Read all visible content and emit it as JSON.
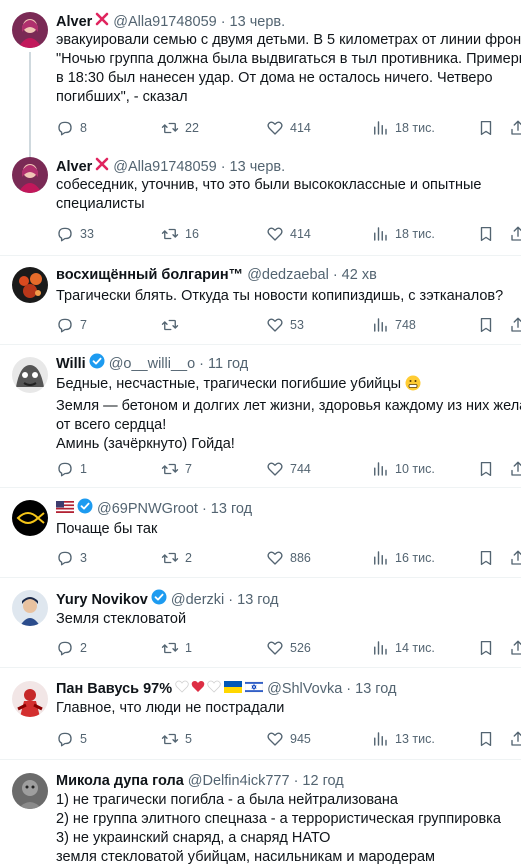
{
  "tweets": [
    {
      "name": "Alver",
      "handle": "@Alla91748059",
      "time": "13 черв.",
      "lines": [
        "эвакуировали семью с двумя детьми. В 5 километрах от линии фронта.",
        "\"Ночью группа должна была выдвигаться в тыл противника. Примерно",
        "в 18:30 был нанесен удар. От дома не осталось ничего. Четверо",
        "погибших\", - сказал"
      ],
      "replies": "8",
      "reposts": "22",
      "likes": "414",
      "views": "18 тис."
    },
    {
      "name": "Alver",
      "handle": "@Alla91748059",
      "time": "13 черв.",
      "lines": [
        "собеседник, уточнив, что это были высококлассные и опытные",
        "специалисты"
      ],
      "replies": "33",
      "reposts": "16",
      "likes": "414",
      "views": "18 тис."
    },
    {
      "name": "восхищённый болгарин™",
      "handle": "@dedzaebal",
      "time": "42 хв",
      "lines": [
        "Трагически блять. Откуда ты новости копипиздишь, с зэтканалов?"
      ],
      "replies": "7",
      "reposts": "",
      "likes": "53",
      "views": "748"
    },
    {
      "name": "Willi",
      "handle": "@o__willi__o",
      "time": "11 год",
      "lines": [
        "Бедные, несчастные, трагически погибшие убийцы",
        "Земля — бетоном и долгих лет жизни, здоровья каждому из них желаю,",
        "от всего сердца!",
        "Аминь (зачёркнуто) Гойда!"
      ],
      "replies": "1",
      "reposts": "7",
      "likes": "744",
      "views": "10 тис."
    },
    {
      "name": "",
      "handle": "@69PNWGroot",
      "time": "13 год",
      "lines": [
        "Почаще бы так"
      ],
      "replies": "3",
      "reposts": "2",
      "likes": "886",
      "views": "16 тис."
    },
    {
      "name": "Yury Novikov",
      "handle": "@derzki",
      "time": "13 год",
      "lines": [
        "Земля стекловатой"
      ],
      "replies": "2",
      "reposts": "1",
      "likes": "526",
      "views": "14 тис."
    },
    {
      "name": "Пан Вавусь 97%",
      "handle": "@ShlVovka",
      "time": "13 год",
      "lines": [
        "Главное, что люди не пострадали"
      ],
      "replies": "5",
      "reposts": "5",
      "likes": "945",
      "views": "13 тис."
    },
    {
      "name": "Микола дупа гола",
      "handle": "@Delfin4ick777",
      "time": "12 год",
      "lines": [
        "1) не трагически погибла - а была нейтрализована",
        "2) не группа элитного спецназа - а террористическая группировка",
        "3) не украинский снаряд, а снаряд НАТО",
        "земля стекловатой убийцам, насильникам и мародерам"
      ],
      "replies": "",
      "reposts": "",
      "likes": "",
      "views": ""
    }
  ],
  "colors": {
    "text": "#0f1419",
    "secondary": "#536471",
    "verified": "#1d9bf0",
    "red_x": "#e0245e",
    "separator": "#eff3f4",
    "thread_line": "#cfd9de"
  },
  "icons": [
    "red-x-icon",
    "verified-badge-icon",
    "reply-icon",
    "repost-icon",
    "like-icon",
    "views-icon",
    "bookmark-icon",
    "share-icon",
    "us-flag-icon",
    "heart-emoji-icon",
    "ukraine-flag-icon",
    "israel-flag-icon",
    "grimace-emoji-icon"
  ]
}
